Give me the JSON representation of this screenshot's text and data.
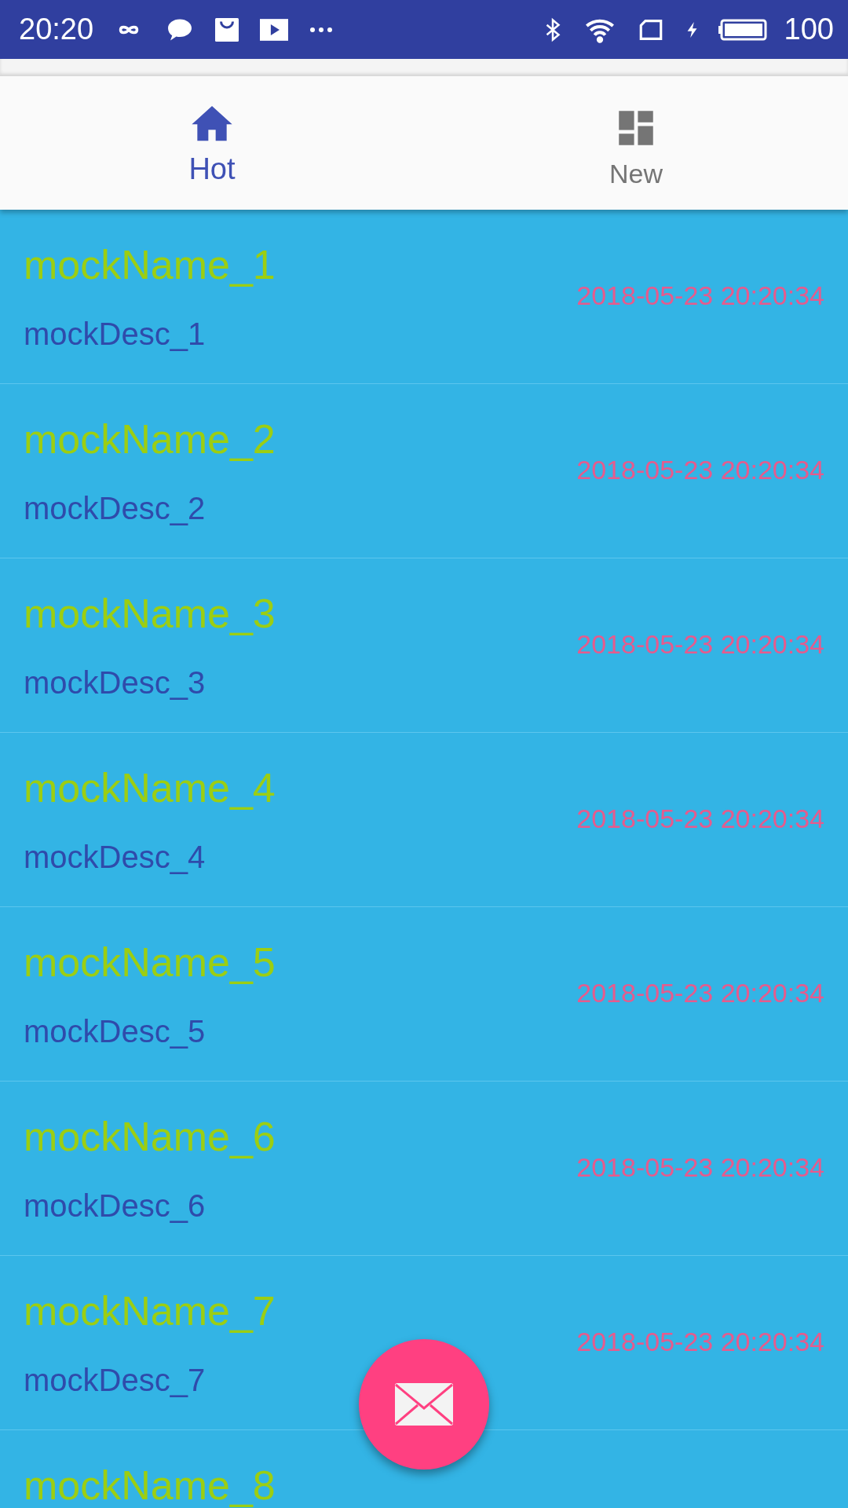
{
  "status_bar": {
    "time": "20:20",
    "battery": "100"
  },
  "tabs": [
    {
      "label": "Hot",
      "selected": true
    },
    {
      "label": "New",
      "selected": false
    }
  ],
  "rows": [
    {
      "name": "mockName_1",
      "desc": "mockDesc_1",
      "date": "2018-05-23 20:20:34"
    },
    {
      "name": "mockName_2",
      "desc": "mockDesc_2",
      "date": "2018-05-23 20:20:34"
    },
    {
      "name": "mockName_3",
      "desc": "mockDesc_3",
      "date": "2018-05-23 20:20:34"
    },
    {
      "name": "mockName_4",
      "desc": "mockDesc_4",
      "date": "2018-05-23 20:20:34"
    },
    {
      "name": "mockName_5",
      "desc": "mockDesc_5",
      "date": "2018-05-23 20:20:34"
    },
    {
      "name": "mockName_6",
      "desc": "mockDesc_6",
      "date": "2018-05-23 20:20:34"
    },
    {
      "name": "mockName_7",
      "desc": "mockDesc_7",
      "date": "2018-05-23 20:20:34"
    },
    {
      "name": "mockName_8"
    }
  ]
}
